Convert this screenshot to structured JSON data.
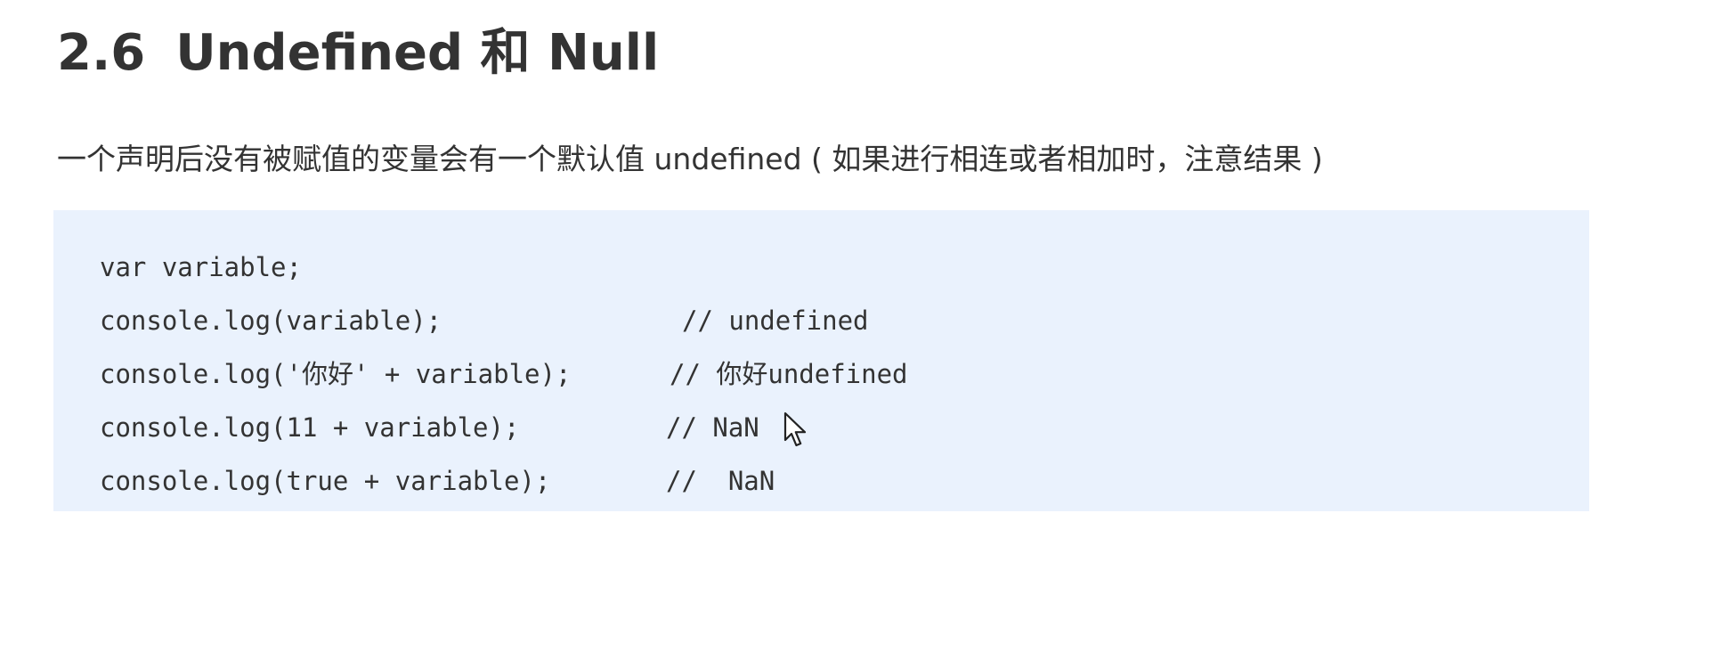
{
  "heading": {
    "number": "2.6",
    "title": "Undefined 和 Null"
  },
  "paragraph": "一个声明后没有被赋值的变量会有一个默认值 undefined ( 如果进行相连或者相加时，注意结果 )",
  "code": {
    "lines": [
      {
        "code": "var variable;",
        "comment": ""
      },
      {
        "code": "console.log(variable);",
        "comment": "// undefined"
      },
      {
        "code": "console.log('你好' + variable);",
        "comment": "// 你好undefined"
      },
      {
        "code": "console.log(11 + variable);",
        "comment": "// NaN"
      },
      {
        "code": "console.log(true + variable);",
        "comment": "//  NaN"
      }
    ]
  },
  "colors": {
    "text": "#333333",
    "code_background": "#eaf2fd"
  },
  "cursor_icon": "mouse-pointer-icon"
}
